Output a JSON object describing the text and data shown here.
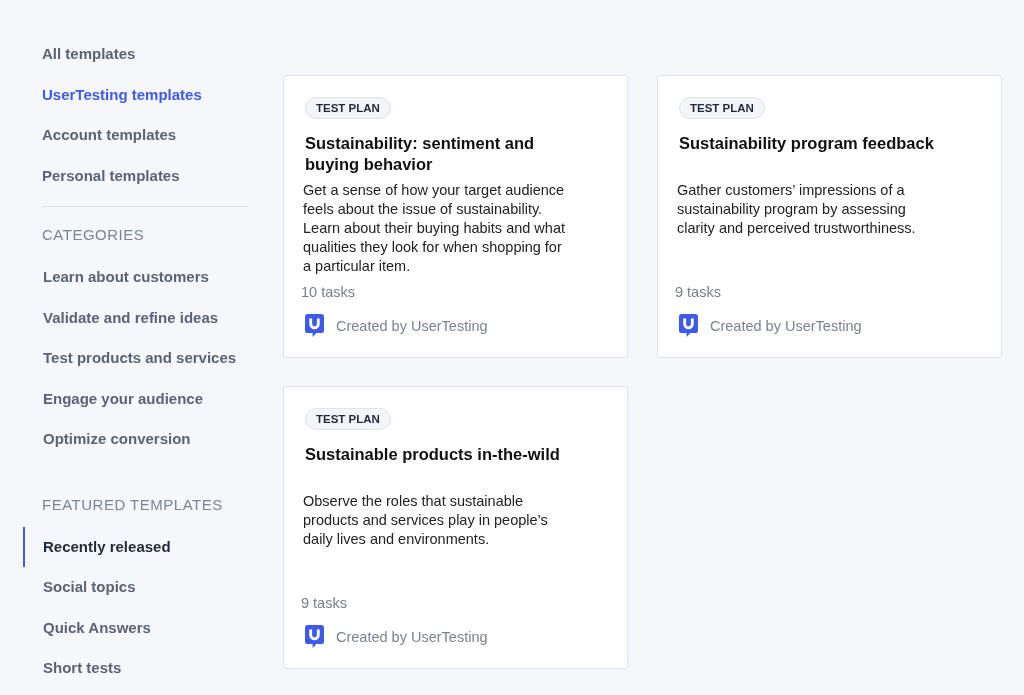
{
  "sidebar": {
    "nav_items": [
      {
        "label": "All templates",
        "selected": false
      },
      {
        "label": "UserTesting templates",
        "selected": true
      },
      {
        "label": "Account templates",
        "selected": false
      },
      {
        "label": "Personal templates",
        "selected": false
      }
    ],
    "sections": [
      {
        "heading": "CATEGORIES",
        "items": [
          {
            "label": "Learn about customers",
            "selected": false
          },
          {
            "label": "Validate and refine ideas",
            "selected": false
          },
          {
            "label": "Test products and services",
            "selected": false
          },
          {
            "label": "Engage your audience",
            "selected": false
          },
          {
            "label": "Optimize conversion",
            "selected": false
          }
        ]
      },
      {
        "heading": "FEATURED TEMPLATES",
        "items": [
          {
            "label": "Recently released",
            "selected": true
          },
          {
            "label": "Social topics",
            "selected": false
          },
          {
            "label": "Quick Answers",
            "selected": false
          },
          {
            "label": "Short tests",
            "selected": false
          }
        ]
      }
    ]
  },
  "cards": [
    {
      "badge": "TEST PLAN",
      "title": "Sustainability: sentiment and buying behavior",
      "description": "Get a sense of how your target audience feels about the issue of sustainability. Learn about their buying habits and what qualities they look for when shopping for a particular item.",
      "tasks": "10 tasks",
      "creator": "Created by UserTesting"
    },
    {
      "badge": "TEST PLAN",
      "title": "Sustainability program feedback",
      "description": "Gather customers’ impressions of a sustainability program by assessing clarity and perceived trustworthiness.",
      "tasks": "9 tasks",
      "creator": "Created by UserTesting"
    },
    {
      "badge": "TEST PLAN",
      "title": "Sustainable products in-the-wild",
      "description": "Observe the roles that sustainable products and services play in people’s daily lives and environments.",
      "tasks": "9 tasks",
      "creator": "Created by UserTesting"
    }
  ]
}
